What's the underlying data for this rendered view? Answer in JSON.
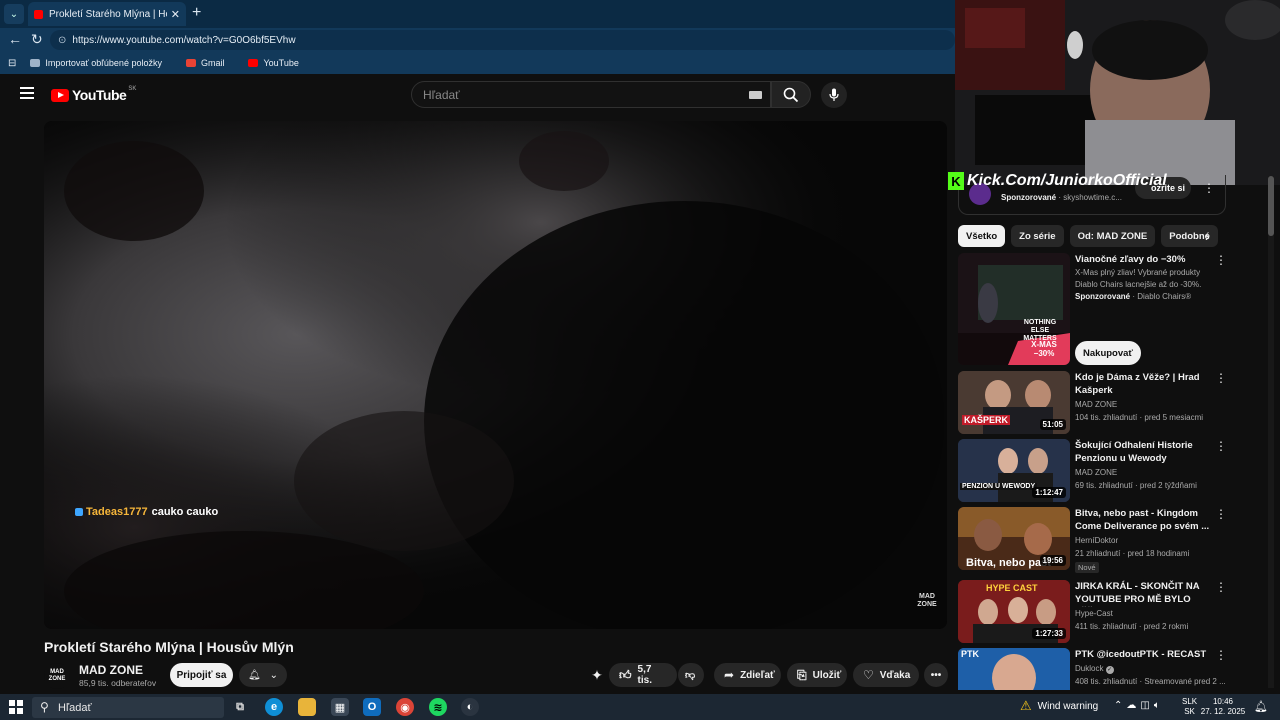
{
  "browser": {
    "tab_title": "Prokletí Starého Mlýna | Housův M",
    "tab_close": "✕",
    "new_tab": "+",
    "url": "https://www.youtube.com/watch?v=G0O6bf5EVhw",
    "favorites": [
      {
        "label": "Importovať obľúbené položky",
        "color": "#9fb3c8"
      },
      {
        "label": "Gmail",
        "color": "#ea4335"
      },
      {
        "label": "YouTube",
        "color": "#ff0000"
      }
    ]
  },
  "youtube": {
    "logo_text": "YouTube",
    "region": "SK",
    "search_placeholder": "Hľadať"
  },
  "player": {
    "chat_user": "Tadeas1777",
    "chat_message": "cauko cauko",
    "watermark": "MAD ZONE"
  },
  "video": {
    "title": "Prokletí Starého Mlýna | Housův Mlýn",
    "channel_name": "MAD ZONE",
    "channel_avatar_text": "MAD ZONE",
    "subscribers": "85,9 tis. odberateľov",
    "join_label": "Pripojiť sa",
    "likes": "5,7 tis.",
    "share_label": "Zdieľať",
    "save_label": "Uložiť",
    "thanks_label": "Vďaka"
  },
  "overlay": {
    "kick_text": "Kick.Com/JuniorkoOfficial"
  },
  "ad_top": {
    "sponsored": "Sponzorované",
    "source": "skyshowtime.c...",
    "button": "ozrite si"
  },
  "chips": [
    {
      "label": "Všetko",
      "active": true
    },
    {
      "label": "Zo série",
      "active": false
    },
    {
      "label": "Od: MAD ZONE",
      "active": false
    },
    {
      "label": "Podobné",
      "active": false
    }
  ],
  "ad_card": {
    "title": "Vianočné zľavy do −30%",
    "line1": "X-Mas plný zliav! Vybrané produkty",
    "line2": "Diablo Chairs lacnejšie až do -30%.",
    "sponsored": "Sponzorované",
    "advertiser": "Diablo Chairs®",
    "cta": "Nakupovať",
    "thumb_text1": "NOTHING ELSE MATTERS",
    "thumb_text2": "X-MAS −30%"
  },
  "recommendations": [
    {
      "title": "Kdo je Dáma z Věže? | Hrad Kašperk",
      "channel": "MAD ZONE",
      "meta": "104 tis. zhliadnutí · pred 5 mesiacmi",
      "duration": "51:05",
      "thumb_text": "KAŠPERK",
      "color": "#3a2a22"
    },
    {
      "title": "Šokující Odhalení Historie Penzionu u Wewody",
      "channel": "MAD ZONE",
      "meta": "69 tis. zhliadnutí · pred 2 týždňami",
      "duration": "1:12:47",
      "thumb_text": "PENZION U WEWODY",
      "color": "#26324a"
    },
    {
      "title": "Bitva, nebo past - Kingdom Come Deliverance po svém ...",
      "channel": "HerníDoktor",
      "meta": "21 zhliadnutí · pred 18 hodinami",
      "badge": "Nové",
      "duration": "19:56",
      "thumb_text": "Bitva, nebo past",
      "color": "#4a2a18"
    },
    {
      "title": "JIRKA KRÁL - SKONČIT NA YOUTUBE PRO MĚ BYLO TĚŽK...",
      "channel": "Hype-Cast",
      "meta": "411 tis. zhliadnutí · pred 2 rokmi",
      "duration": "1:27:33",
      "thumb_text": "HYPE CAST",
      "color": "#6a1a1a"
    },
    {
      "title": "PTK @icedoutPTK - RECAST",
      "channel": "Duklock",
      "meta": "408 tis. zhliadnutí · Streamované pred 2 ...",
      "duration": "",
      "thumb_text": "PTK",
      "color": "#1e5fa8"
    }
  ],
  "taskbar": {
    "search_placeholder": "Hľadať",
    "weather": "Wind warning",
    "lang_top": "SLK",
    "lang_bottom": "SK",
    "time": "10:46",
    "date": "27. 12. 2025"
  }
}
